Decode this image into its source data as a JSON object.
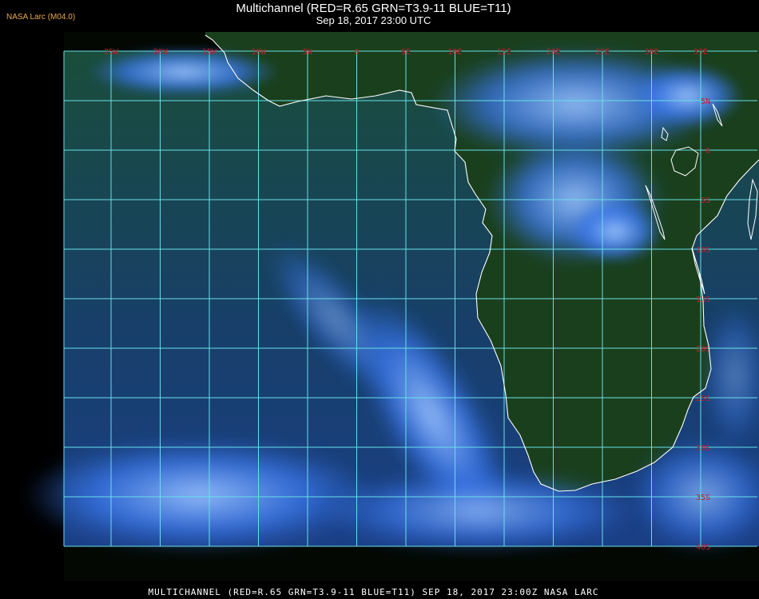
{
  "header": {
    "title": "Multichannel (RED=R.65 GRN=T3.9-11 BLUE=T11)",
    "timestamp": "Sep 18, 2017 23:00 UTC",
    "credit": "NASA Larc (M04.0)"
  },
  "footer": {
    "caption": "MULTICHANNEL (RED=R.65 GRN=T3.9-11 BLUE=T11) SEP 18, 2017 23:00Z   NASA LARC"
  },
  "map": {
    "longitudes": [
      {
        "label": "25W",
        "value": -25
      },
      {
        "label": "20W",
        "value": -20
      },
      {
        "label": "15W",
        "value": -15
      },
      {
        "label": "10W",
        "value": -10
      },
      {
        "label": "5W",
        "value": -5
      },
      {
        "label": "0",
        "value": 0
      },
      {
        "label": "5E",
        "value": 5
      },
      {
        "label": "10E",
        "value": 10
      },
      {
        "label": "15E",
        "value": 15
      },
      {
        "label": "20E",
        "value": 20
      },
      {
        "label": "25E",
        "value": 25
      },
      {
        "label": "30E",
        "value": 30
      },
      {
        "label": "35E",
        "value": 35
      }
    ],
    "latitudes": [
      {
        "label": "5N",
        "value": 5
      },
      {
        "label": "0",
        "value": 0
      },
      {
        "label": "5S",
        "value": -5
      },
      {
        "label": "10S",
        "value": -10
      },
      {
        "label": "15S",
        "value": -15
      },
      {
        "label": "20S",
        "value": -20
      },
      {
        "label": "25S",
        "value": -25
      },
      {
        "label": "30S",
        "value": -30
      },
      {
        "label": "35S",
        "value": -35
      },
      {
        "label": "40S",
        "value": -40
      }
    ],
    "lon_range": [
      -30,
      35
    ],
    "lat_range": [
      -40,
      10
    ],
    "colors": {
      "ocean": "#143a63",
      "land": "#163d1d",
      "cloud": "#2f6fe0",
      "grid": "#66e0e8",
      "coast": "#ffffff",
      "label": "#c0202a"
    }
  }
}
